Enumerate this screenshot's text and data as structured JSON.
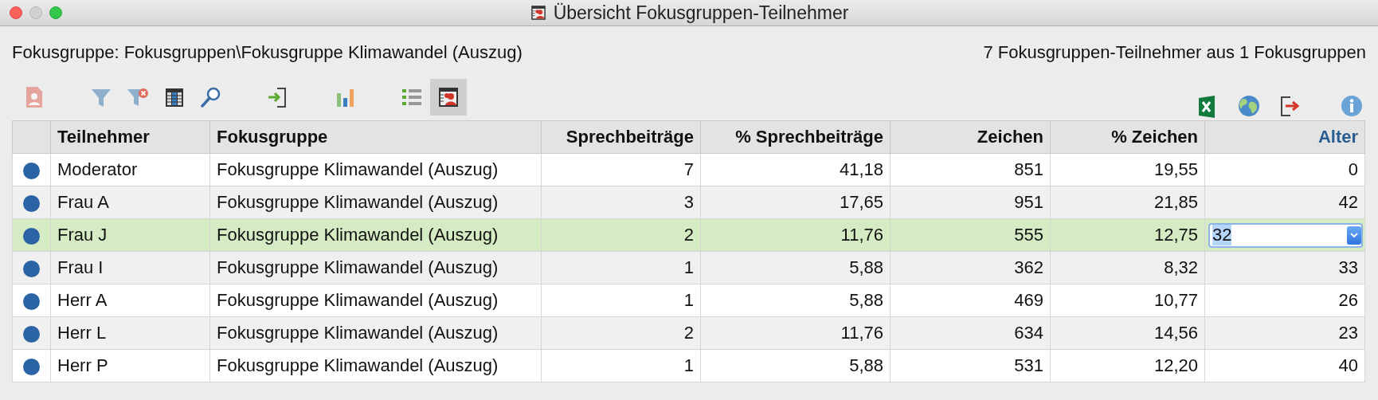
{
  "window": {
    "title": "Übersicht Fokusgruppen-Teilnehmer"
  },
  "info": {
    "group_path": "Fokusgruppe: Fokusgruppen\\Fokusgruppe Klimawandel (Auszug)",
    "summary": "7 Fokusgruppen-Teilnehmer aus 1 Fokusgruppen"
  },
  "toolbar": {
    "left_groups": [
      [
        {
          "kind": "person-doc",
          "disabled": true,
          "selected": false
        }
      ],
      [
        {
          "kind": "filter",
          "disabled": false,
          "selected": false
        },
        {
          "kind": "filter-clear",
          "disabled": false,
          "selected": false
        },
        {
          "kind": "columns",
          "disabled": false,
          "selected": false
        },
        {
          "kind": "search",
          "disabled": false,
          "selected": false
        }
      ],
      [
        {
          "kind": "import",
          "disabled": false,
          "selected": false
        }
      ],
      [
        {
          "kind": "chart",
          "disabled": false,
          "selected": false
        }
      ],
      [
        {
          "kind": "list",
          "disabled": false,
          "selected": false
        },
        {
          "kind": "participants",
          "disabled": false,
          "selected": true
        }
      ]
    ],
    "right": [
      {
        "kind": "excel"
      },
      {
        "kind": "globe"
      },
      {
        "kind": "export"
      },
      {
        "kind": "info"
      }
    ]
  },
  "table": {
    "columns": [
      {
        "label": "Teilnehmer",
        "sorted": false
      },
      {
        "label": "Fokusgruppe",
        "sorted": false
      },
      {
        "label": "Sprechbeiträge",
        "sorted": false
      },
      {
        "label": "% Sprechbeiträge",
        "sorted": false
      },
      {
        "label": "Zeichen",
        "sorted": false
      },
      {
        "label": "% Zeichen",
        "sorted": false
      },
      {
        "label": "Alter",
        "sorted": true
      }
    ],
    "rows": [
      {
        "color": "#2a64a4",
        "participant": "Moderator",
        "group": "Fokusgruppe Klimawandel (Auszug)",
        "contributions": "7",
        "contributions_pct": "41,18",
        "chars": "851",
        "chars_pct": "19,55",
        "age": "0",
        "selected": false,
        "editing": false
      },
      {
        "color": "#2a64a4",
        "participant": "Frau A",
        "group": "Fokusgruppe Klimawandel (Auszug)",
        "contributions": "3",
        "contributions_pct": "17,65",
        "chars": "951",
        "chars_pct": "21,85",
        "age": "42",
        "selected": false,
        "editing": false
      },
      {
        "color": "#2a64a4",
        "participant": "Frau J",
        "group": "Fokusgruppe Klimawandel (Auszug)",
        "contributions": "2",
        "contributions_pct": "11,76",
        "chars": "555",
        "chars_pct": "12,75",
        "age": "32",
        "selected": true,
        "editing": true
      },
      {
        "color": "#2a64a4",
        "participant": "Frau I",
        "group": "Fokusgruppe Klimawandel (Auszug)",
        "contributions": "1",
        "contributions_pct": "5,88",
        "chars": "362",
        "chars_pct": "8,32",
        "age": "33",
        "selected": false,
        "editing": false
      },
      {
        "color": "#2a64a4",
        "participant": "Herr A",
        "group": "Fokusgruppe Klimawandel (Auszug)",
        "contributions": "1",
        "contributions_pct": "5,88",
        "chars": "469",
        "chars_pct": "10,77",
        "age": "26",
        "selected": false,
        "editing": false
      },
      {
        "color": "#2a64a4",
        "participant": "Herr L",
        "group": "Fokusgruppe Klimawandel (Auszug)",
        "contributions": "2",
        "contributions_pct": "11,76",
        "chars": "634",
        "chars_pct": "14,56",
        "age": "23",
        "selected": false,
        "editing": false
      },
      {
        "color": "#2a64a4",
        "participant": "Herr P",
        "group": "Fokusgruppe Klimawandel (Auszug)",
        "contributions": "1",
        "contributions_pct": "5,88",
        "chars": "531",
        "chars_pct": "12,20",
        "age": "40",
        "selected": false,
        "editing": false
      }
    ]
  }
}
